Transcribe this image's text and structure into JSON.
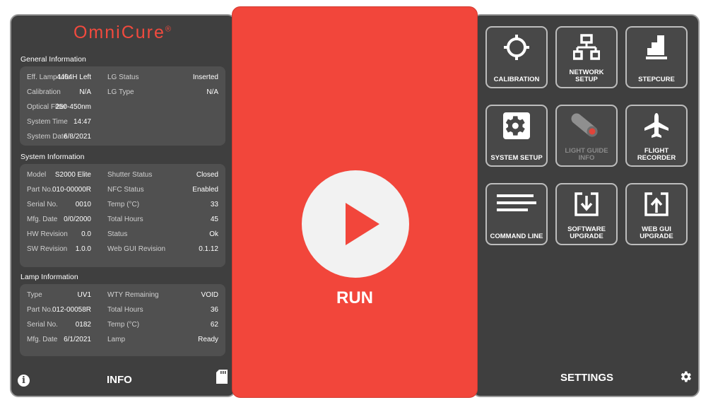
{
  "logo": {
    "text": "OmniCure",
    "mark": "®"
  },
  "general": {
    "title": "General Information",
    "rows": [
      {
        "label": "Eff. Lamp Life",
        "value": "4464H Left",
        "label2": "LG Status",
        "value2": "Inserted"
      },
      {
        "label": "Calibration",
        "value": "N/A",
        "label2": "LG Type",
        "value2": "N/A"
      },
      {
        "label": "Optical Filter",
        "value": "250-450nm",
        "label2": "",
        "value2": ""
      },
      {
        "label": "System Time",
        "value": "14:47",
        "label2": "",
        "value2": ""
      },
      {
        "label": "System Date",
        "value": "6/8/2021",
        "label2": "",
        "value2": ""
      }
    ]
  },
  "system": {
    "title": "System Information",
    "rows": [
      {
        "label": "Model",
        "value": "S2000 Elite",
        "label2": "Shutter Status",
        "value2": "Closed"
      },
      {
        "label": "Part No.",
        "value": "010-00000R",
        "label2": "NFC Status",
        "value2": "Enabled"
      },
      {
        "label": "Serial No.",
        "value": "0010",
        "label2": "Temp (°C)",
        "value2": "33"
      },
      {
        "label": "Mfg. Date",
        "value": "0/0/2000",
        "label2": "Total Hours",
        "value2": "45"
      },
      {
        "label": "HW Revision",
        "value": "0.0",
        "label2": "Status",
        "value2": "Ok"
      },
      {
        "label": "SW Revision",
        "value": "1.0.0",
        "label2": "Web GUI Revision",
        "value2": "0.1.12"
      }
    ]
  },
  "lamp": {
    "title": "Lamp Information",
    "rows": [
      {
        "label": "Type",
        "value": "UV1",
        "label2": "WTY Remaining",
        "value2": "VOID"
      },
      {
        "label": "Part No.",
        "value": "012-00058R",
        "label2": "Total Hours",
        "value2": "36"
      },
      {
        "label": "Serial No.",
        "value": "0182",
        "label2": "Temp (°C)",
        "value2": "62"
      },
      {
        "label": "Mfg. Date",
        "value": "6/1/2021",
        "label2": "Lamp",
        "value2": "Ready"
      }
    ]
  },
  "left_footer": {
    "label": "INFO"
  },
  "run": {
    "label": "RUN"
  },
  "tiles": [
    {
      "label": "CALIBRATION",
      "icon": "crosshair-icon",
      "enabled": true
    },
    {
      "label": "NETWORK SETUP",
      "icon": "network-icon",
      "enabled": true
    },
    {
      "label": "STEPCURE",
      "icon": "stepcure-icon",
      "enabled": true
    },
    {
      "label": "SYSTEM SETUP",
      "icon": "gear-icon",
      "enabled": true
    },
    {
      "label": "LIGHT GUIDE INFO",
      "icon": "light-guide-icon",
      "enabled": false
    },
    {
      "label": "FLIGHT RECORDER",
      "icon": "airplane-icon",
      "enabled": true
    },
    {
      "label": "COMMAND LINE",
      "icon": "command-lines-icon",
      "enabled": true
    },
    {
      "label": "SOFTWARE UPGRADE",
      "icon": "download-icon",
      "enabled": true
    },
    {
      "label": "WEB GUI UPGRADE",
      "icon": "upload-icon",
      "enabled": true
    }
  ],
  "right_footer": {
    "label": "SETTINGS"
  },
  "colors": {
    "accent": "#f2463b",
    "panel": "#3f3f3f",
    "card": "#505050"
  }
}
